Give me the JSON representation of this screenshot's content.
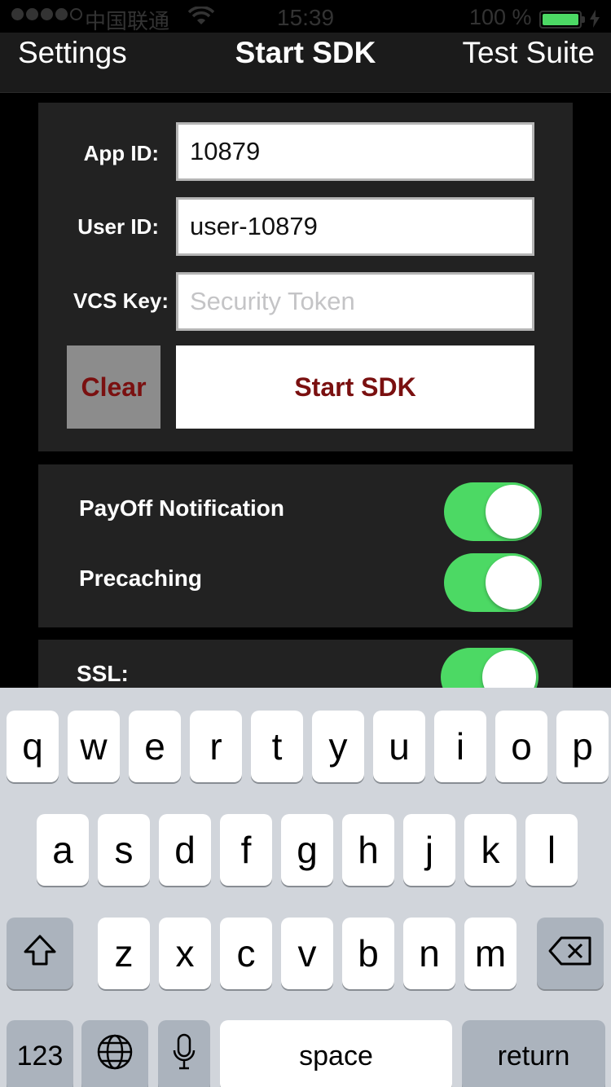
{
  "status_bar": {
    "carrier": "中国联通",
    "time": "15:39",
    "battery_percent": "100 %",
    "battery_level": 1.0,
    "signal_bars_filled": 4,
    "signal_bars_total": 5
  },
  "nav": {
    "left_label": "Settings",
    "title": "Start SDK",
    "right_label": "Test Suite"
  },
  "form": {
    "app_id_label": "App ID:",
    "app_id_value": "10879",
    "user_id_label": "User ID:",
    "user_id_value": "user-10879",
    "vcs_key_label": "VCS Key:",
    "vcs_key_placeholder": "Security Token",
    "clear_label": "Clear",
    "start_label": "Start SDK"
  },
  "toggles": {
    "payoff_label": "PayOff Notification",
    "payoff_on": true,
    "precaching_label": "Precaching",
    "precaching_on": true,
    "ssl_label": "SSL:",
    "ssl_on": true
  },
  "keyboard": {
    "row1": [
      "q",
      "w",
      "e",
      "r",
      "t",
      "y",
      "u",
      "i",
      "o",
      "p"
    ],
    "row2": [
      "a",
      "s",
      "d",
      "f",
      "g",
      "h",
      "j",
      "k",
      "l"
    ],
    "row3": [
      "z",
      "x",
      "c",
      "v",
      "b",
      "n",
      "m"
    ],
    "numbers_label": "123",
    "space_label": "space",
    "return_label": "return",
    "shift_icon": "shift-icon",
    "delete_icon": "delete-icon",
    "globe_icon": "globe-icon",
    "mic_icon": "microphone-icon"
  },
  "colors": {
    "toggle_on": "#4cd964",
    "button_text": "#7a1010",
    "panel_bg": "#222222",
    "keyboard_bg": "#d1d5db"
  }
}
